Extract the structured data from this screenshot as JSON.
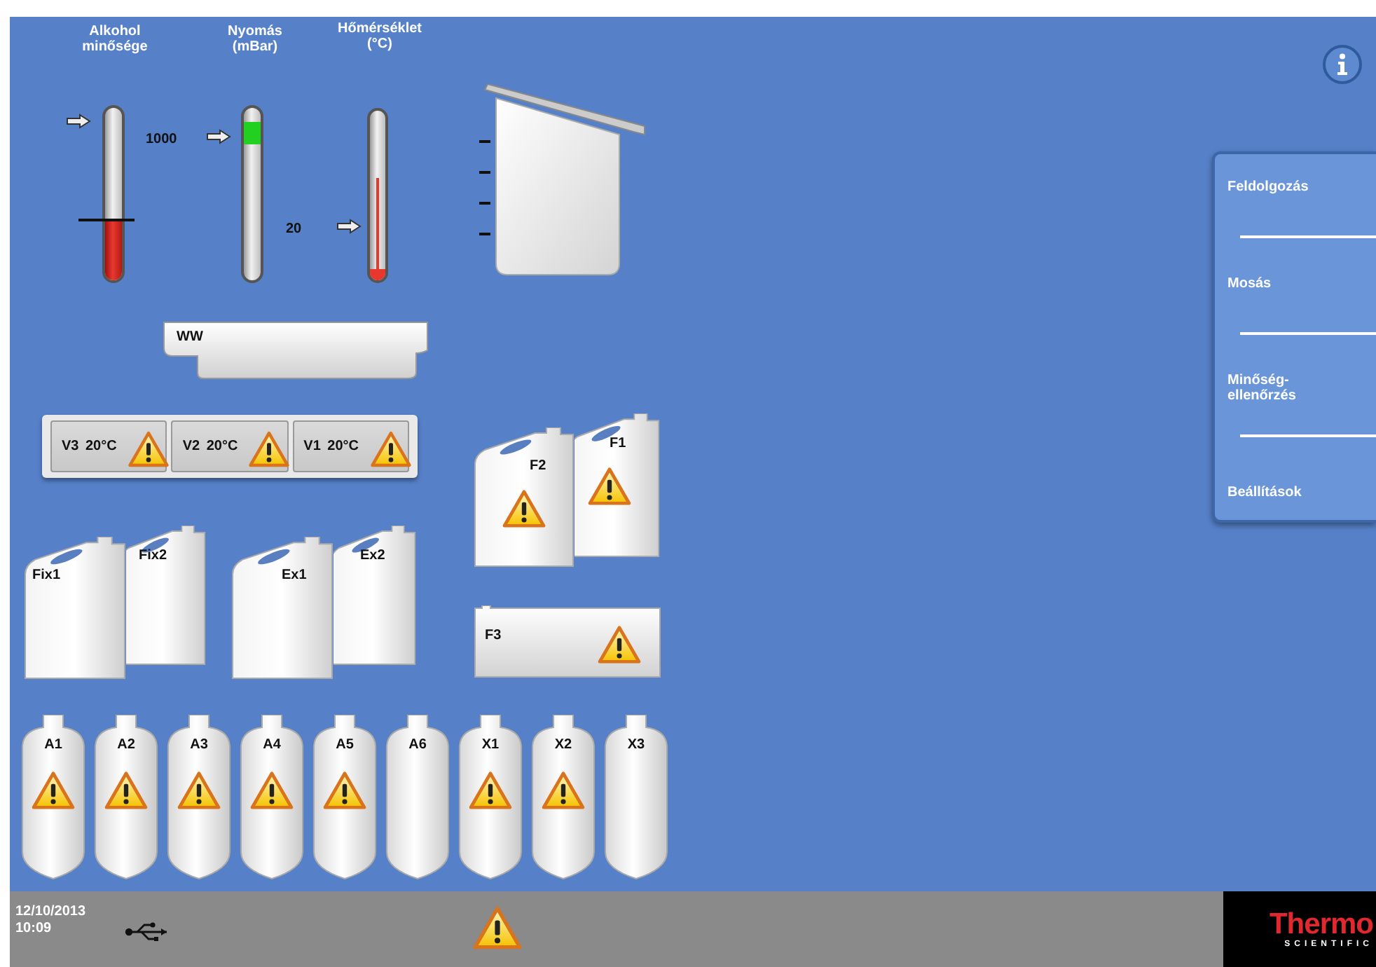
{
  "gauges": [
    {
      "kind": "alcohol",
      "label": "Alkohol minősége",
      "level": 0.36
    },
    {
      "kind": "pressure",
      "label": "Nyomás (mBar)",
      "reading": "1000"
    },
    {
      "kind": "temperature",
      "label": "Hőmérséklet (°C)",
      "reading": "20",
      "level": 0.6
    }
  ],
  "waste_tray": {
    "label": "WW"
  },
  "wax_baths": [
    {
      "label": "V3",
      "temperature": "20°C",
      "warning": true
    },
    {
      "label": "V2",
      "temperature": "20°C",
      "warning": true
    },
    {
      "label": "V1",
      "temperature": "20°C",
      "warning": true
    }
  ],
  "canisters": [
    {
      "label": "Fix2",
      "warning": false
    },
    {
      "label": "Fix1",
      "warning": false
    },
    {
      "label": "Ex2",
      "warning": false
    },
    {
      "label": "Ex1",
      "warning": false
    },
    {
      "label": "F1",
      "warning": true
    },
    {
      "label": "F2",
      "warning": true
    }
  ],
  "flat_container": {
    "label": "F3",
    "warning": true
  },
  "bottles": [
    {
      "label": "A1",
      "warning": true
    },
    {
      "label": "A2",
      "warning": true
    },
    {
      "label": "A3",
      "warning": true
    },
    {
      "label": "A4",
      "warning": true
    },
    {
      "label": "A5",
      "warning": true
    },
    {
      "label": "A6",
      "warning": false
    },
    {
      "label": "X1",
      "warning": true
    },
    {
      "label": "X2",
      "warning": true
    },
    {
      "label": "X3",
      "warning": false
    }
  ],
  "menu": [
    {
      "label": "Feldolgozás"
    },
    {
      "label": "Mosás"
    },
    {
      "label": "Minőség-ellenőrzés"
    },
    {
      "label": "Beállítások"
    }
  ],
  "status_bar": {
    "date": "12/10/2013",
    "time": "10:09",
    "warning": true
  },
  "logo": {
    "name": "Thermo",
    "subtitle": "SCIENTIFIC"
  }
}
